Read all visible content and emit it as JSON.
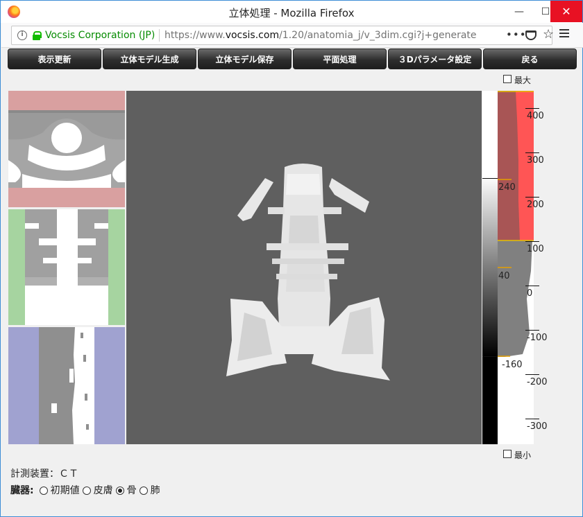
{
  "window": {
    "title": "立体処理 - Mozilla Firefox",
    "min": "—",
    "max": "☐",
    "close": "✕"
  },
  "browser": {
    "info": "i",
    "org": "Vocsis Corporation (JP)",
    "url_prefix": "https://www.",
    "url_domain": "vocsis.com",
    "url_rest": "/1.20/anatomia_j/v_3dim.cgi?j+generate",
    "actions": "•••",
    "star": "☆"
  },
  "toolbar": {
    "buttons": [
      "表示更新",
      "立体モデル生成",
      "立体モデル保存",
      "平面処理",
      "３Dパラメータ設定",
      "戻る"
    ]
  },
  "window_level": {
    "max_label": "最大",
    "min_label": "最小",
    "upper_value": "240",
    "mid_value": "40",
    "lower_value": "-160"
  },
  "scale": {
    "ticks": [
      "400",
      "300",
      "200",
      "100",
      "0",
      "-100",
      "-200",
      "-300"
    ]
  },
  "footer": {
    "device_label": "計測装置：ＣＴ",
    "organ_label": "臓器:",
    "options": [
      {
        "label": "初期値",
        "checked": false
      },
      {
        "label": "皮膚",
        "checked": false
      },
      {
        "label": "骨",
        "checked": true
      },
      {
        "label": "肺",
        "checked": false
      }
    ]
  },
  "colors": {
    "highlight_red": "#ff5555",
    "thumb_red": "#d9a0a0",
    "thumb_green": "#a6d4a0",
    "thumb_blue": "#a0a2d0",
    "viewport_bg": "#5f5f5f"
  }
}
